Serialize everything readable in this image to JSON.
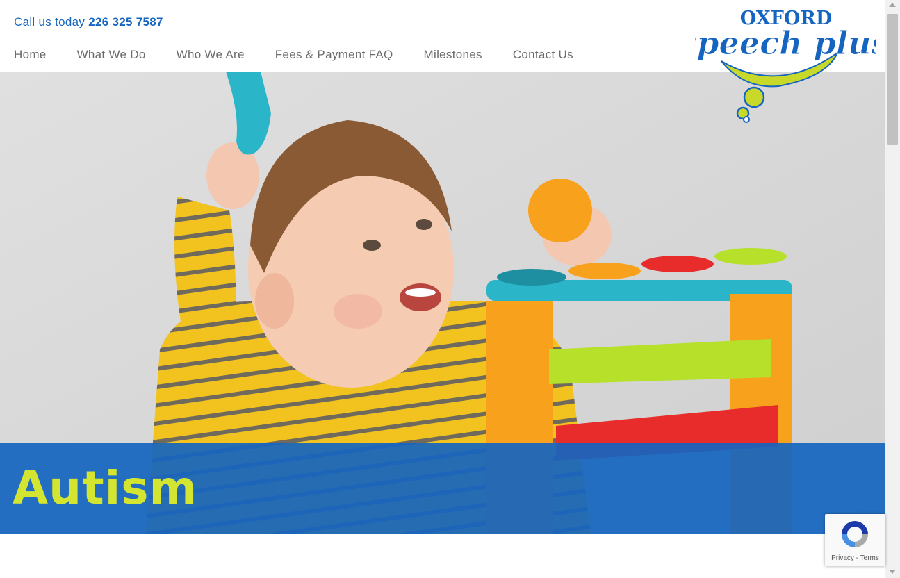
{
  "header": {
    "call_prefix": "Call us today",
    "phone": "226 325 7587"
  },
  "nav": {
    "items": [
      {
        "label": "Home"
      },
      {
        "label": "What We Do"
      },
      {
        "label": "Who We Are"
      },
      {
        "label": "Fees & Payment FAQ"
      },
      {
        "label": "Milestones"
      },
      {
        "label": "Contact Us"
      }
    ]
  },
  "logo": {
    "line1": "OXFORD",
    "line2": "speech plus"
  },
  "hero": {
    "title": "Autism"
  },
  "recaptcha": {
    "privacy": "Privacy",
    "separator": " - ",
    "terms": "Terms"
  },
  "colors": {
    "brand_blue": "#1565c0",
    "brand_green": "#c8d92a",
    "nav_text": "#6b6b6b"
  }
}
